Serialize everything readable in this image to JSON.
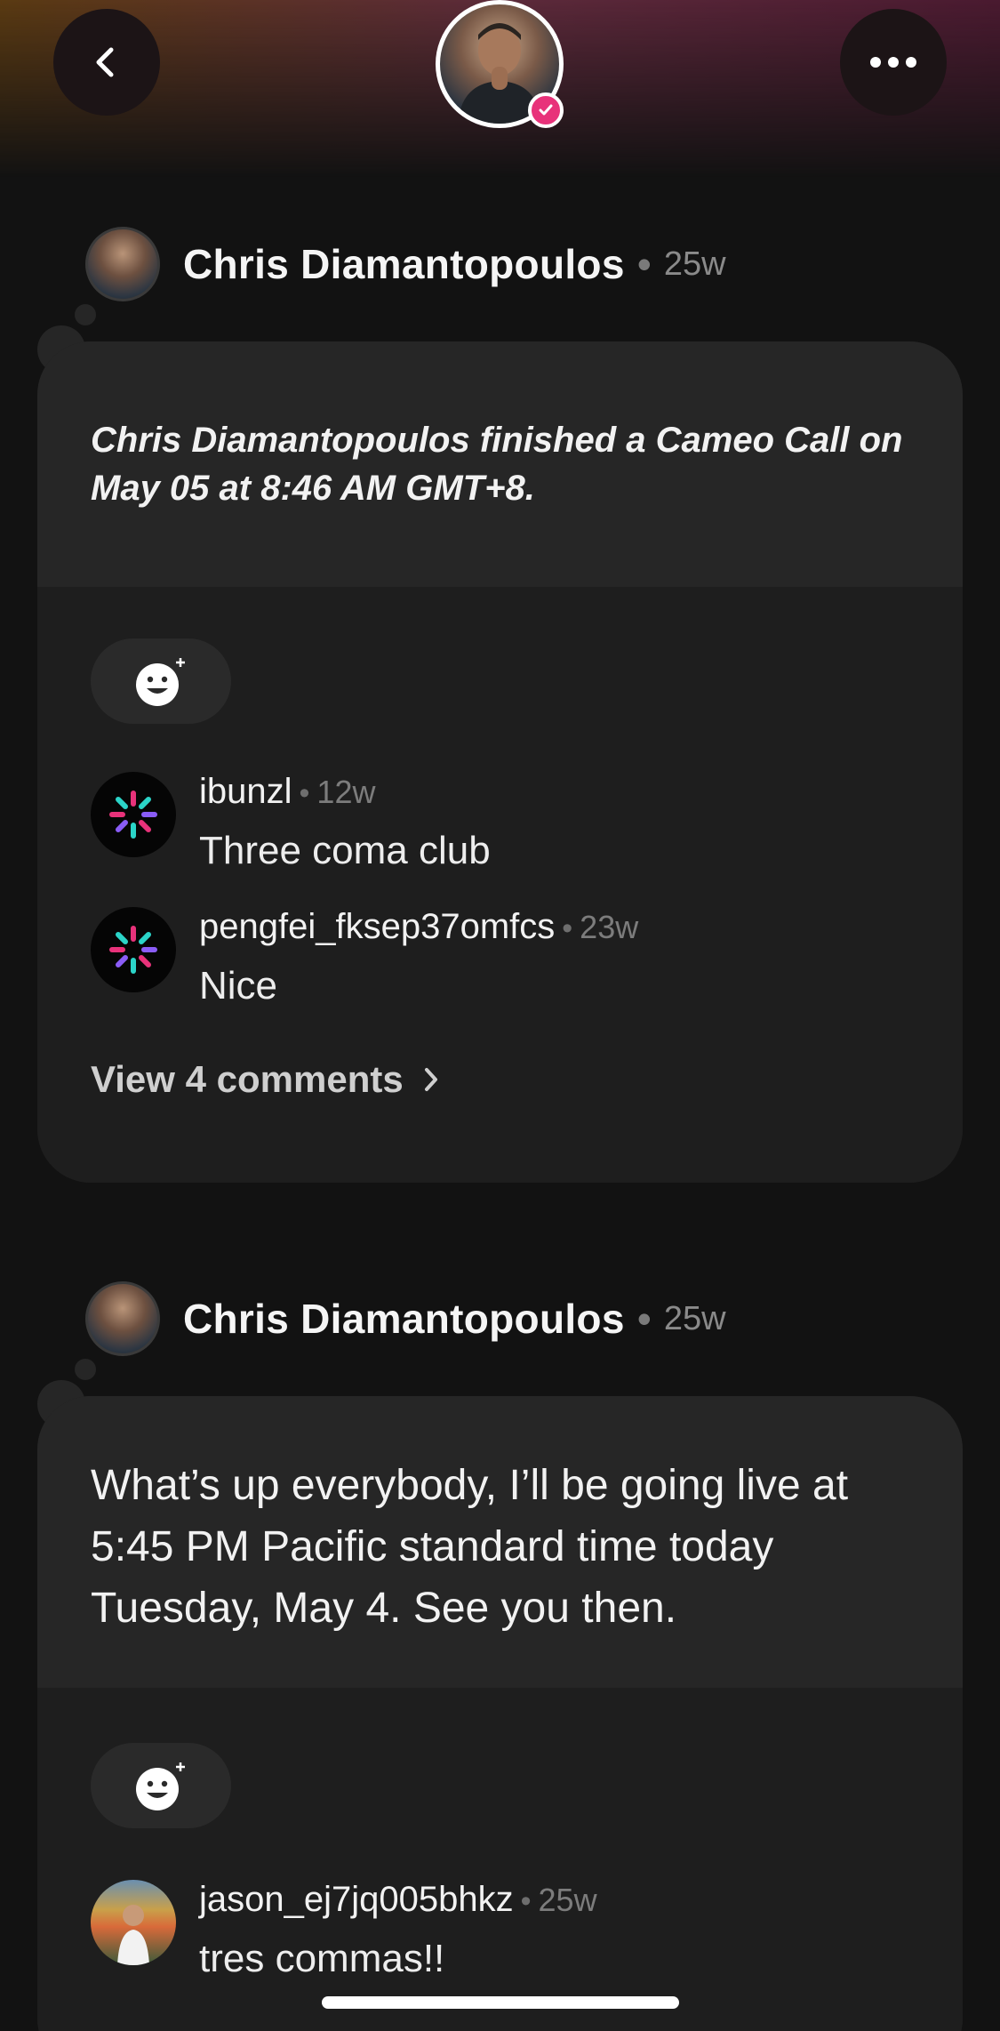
{
  "header": {
    "back_icon": "chevron-left-icon",
    "more_icon": "ellipsis-icon",
    "verified_color": "#e8327a"
  },
  "posts": [
    {
      "author": "Chris Diamantopoulos",
      "separator": "•",
      "age": "25w",
      "text": "Chris Diamantopoulos finished a Cameo Call on May 05 at 8:46 AM GMT+8.",
      "comments": [
        {
          "user": "ibunzl",
          "separator": "•",
          "age": "12w",
          "text": "Three coma club"
        },
        {
          "user": "pengfei_fksep37omfcs",
          "separator": "•",
          "age": "23w",
          "text": "Nice"
        }
      ],
      "view_comments": "View 4 comments"
    },
    {
      "author": "Chris Diamantopoulos",
      "separator": "•",
      "age": "25w",
      "text": "What’s up everybody, I’ll be going live at 5:45 PM Pacific standard time today Tuesday, May 4. See you then.",
      "comments": [
        {
          "user": "jason_ej7jq005bhkz",
          "separator": "•",
          "age": "25w",
          "text": "tres commas!!"
        }
      ]
    }
  ]
}
